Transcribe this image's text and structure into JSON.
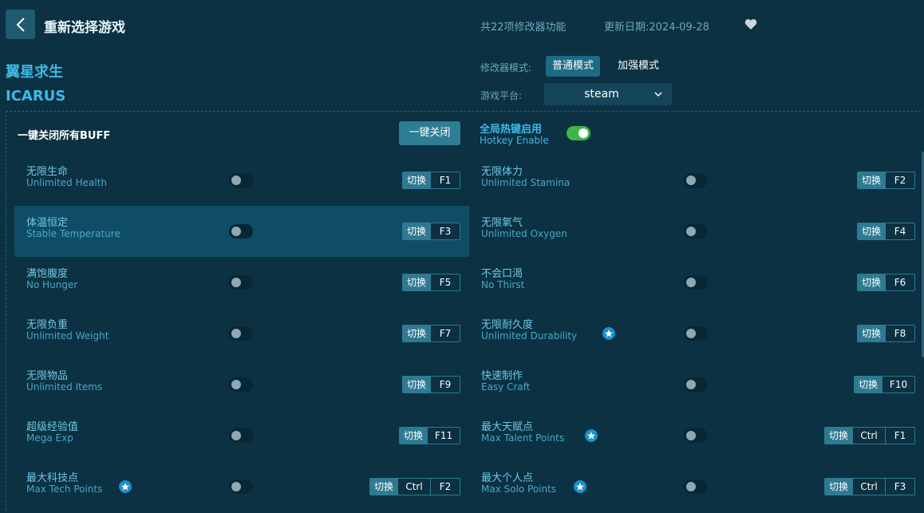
{
  "header": {
    "title": "重新选择游戏",
    "feature_count": "共22项修改器功能",
    "update_date": "更新日期:2024-09-28"
  },
  "game": {
    "name_cn": "翼星求生",
    "name_en": "ICARUS"
  },
  "mode": {
    "label": "修改器模式:",
    "normal": "普通模式",
    "enhanced": "加强模式",
    "selected": "普通模式"
  },
  "platform": {
    "label": "游戏平台:",
    "value": "steam"
  },
  "buff": {
    "label": "一键关闭所有BUFF",
    "button": "一键关闭"
  },
  "hotkey": {
    "title_cn": "全局热键启用",
    "title_en": "Hotkey Enable",
    "enabled": true
  },
  "switch_label": "切换",
  "features": [
    {
      "cn": "无限生命",
      "en": "Unlimited Health",
      "keys": [
        "F1"
      ],
      "star": false,
      "on": false
    },
    {
      "cn": "无限体力",
      "en": "Unlimited Stamina",
      "keys": [
        "F2"
      ],
      "star": false,
      "on": false
    },
    {
      "cn": "体温恒定",
      "en": "Stable Temperature",
      "keys": [
        "F3"
      ],
      "star": false,
      "on": false,
      "highlight": true
    },
    {
      "cn": "无限氧气",
      "en": "Unlimited Oxygen",
      "keys": [
        "F4"
      ],
      "star": false,
      "on": false
    },
    {
      "cn": "满饱腹度",
      "en": "No Hunger",
      "keys": [
        "F5"
      ],
      "star": false,
      "on": false
    },
    {
      "cn": "不会口渴",
      "en": "No Thirst",
      "keys": [
        "F6"
      ],
      "star": false,
      "on": false
    },
    {
      "cn": "无限负重",
      "en": "Unlimited Weight",
      "keys": [
        "F7"
      ],
      "star": false,
      "on": false
    },
    {
      "cn": "无限耐久度",
      "en": "Unlimited Durability",
      "keys": [
        "F8"
      ],
      "star": true,
      "on": false
    },
    {
      "cn": "无限物品",
      "en": "Unlimited Items",
      "keys": [
        "F9"
      ],
      "star": false,
      "on": false
    },
    {
      "cn": "快速制作",
      "en": "Easy Craft",
      "keys": [
        "F10"
      ],
      "star": false,
      "on": false
    },
    {
      "cn": "超级经验值",
      "en": "Mega Exp",
      "keys": [
        "F11"
      ],
      "star": false,
      "on": false
    },
    {
      "cn": "最大天赋点",
      "en": "Max Talent Points",
      "keys": [
        "Ctrl",
        "F1"
      ],
      "star": true,
      "on": false
    },
    {
      "cn": "最大科技点",
      "en": "Max Tech Points",
      "keys": [
        "Ctrl",
        "F2"
      ],
      "star": true,
      "on": false
    },
    {
      "cn": "最大个人点",
      "en": "Max Solo Points",
      "keys": [
        "Ctrl",
        "F3"
      ],
      "star": true,
      "on": false
    }
  ],
  "colors": {
    "background": "#0b3142",
    "accent": "#3cb9e6",
    "toggle_on": "#3fb54a",
    "highlight_row": "#0f4d66"
  }
}
